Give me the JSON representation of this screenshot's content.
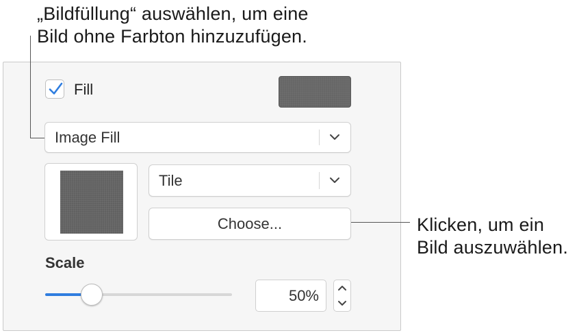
{
  "callouts": {
    "top_line1": "„Bildfüllung“ auswählen, um eine",
    "top_line2": "Bild ohne Farbton hinzuzufügen.",
    "right_line1": "Klicken, um ein",
    "right_line2": "Bild auszuwählen."
  },
  "fill": {
    "label": "Fill",
    "checked": true,
    "swatch_color": "#666666"
  },
  "fill_type": {
    "selected": "Image Fill"
  },
  "image_mode": {
    "selected": "Tile"
  },
  "choose_button": {
    "label": "Choose..."
  },
  "scale": {
    "label": "Scale",
    "value_text": "50%",
    "slider_fraction": 0.25
  },
  "colors": {
    "accent": "#2f7ddf",
    "panel_bg": "#f6f6f6",
    "swatch_gray": "#666666"
  },
  "icons": {
    "checkbox": "checkmark-icon",
    "popup": "chevron-down-icon",
    "stepper_up": "chevron-up-icon",
    "stepper_down": "chevron-down-icon"
  }
}
